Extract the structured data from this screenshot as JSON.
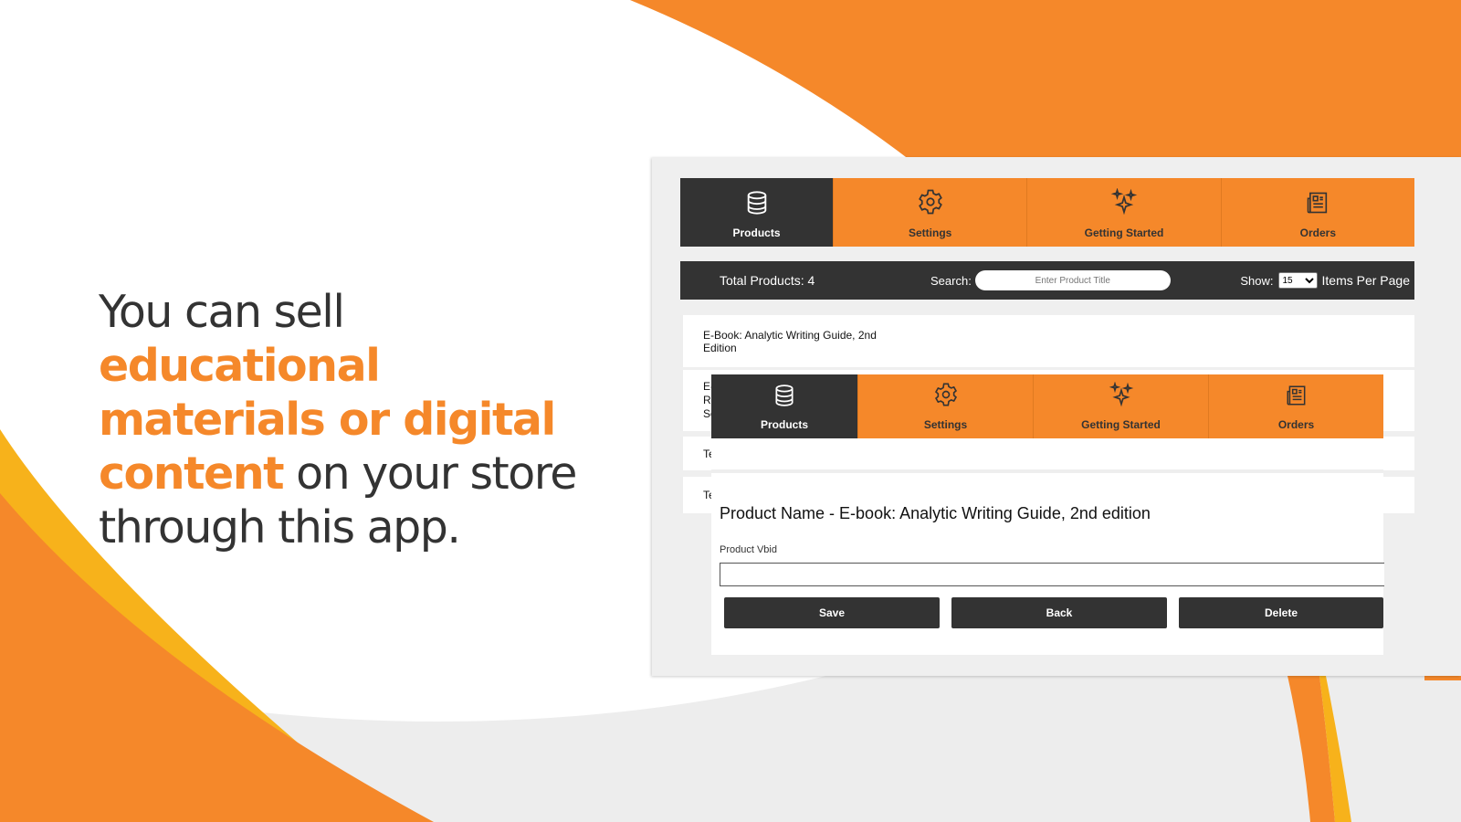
{
  "headline": {
    "part1": "You can sell ",
    "highlight": "educational materials or digital content",
    "part2": " on your store through this app."
  },
  "colors": {
    "accent": "#f5882a",
    "dark": "#333333",
    "yellow": "#f7b21b"
  },
  "nav": {
    "tabs": [
      {
        "label": "Products",
        "icon": "database-icon"
      },
      {
        "label": "Settings",
        "icon": "gear-icon"
      },
      {
        "label": "Getting Started",
        "icon": "sparkles-icon"
      },
      {
        "label": "Orders",
        "icon": "newspaper-icon"
      }
    ]
  },
  "toolbar": {
    "total": "Total Products: 4",
    "search_label": "Search:",
    "search_placeholder": "Enter Product Title",
    "show_label": "Show:",
    "per_page": "15",
    "items_per_page": "Items Per Page"
  },
  "rows": [
    {
      "line1": "E-Book: Analytic Writing Guide, 2nd",
      "line2": "Edition"
    },
    {
      "line1": "E-",
      "line2": "Ri",
      "line3": "Se"
    },
    {
      "line1": "Te"
    },
    {
      "line1": "Te"
    }
  ],
  "detail": {
    "title": "Product Name - E-book: Analytic Writing Guide, 2nd edition",
    "vbid_label": "Product Vbid",
    "vbid_value": "",
    "save": "Save",
    "back": "Back",
    "delete": "Delete"
  }
}
